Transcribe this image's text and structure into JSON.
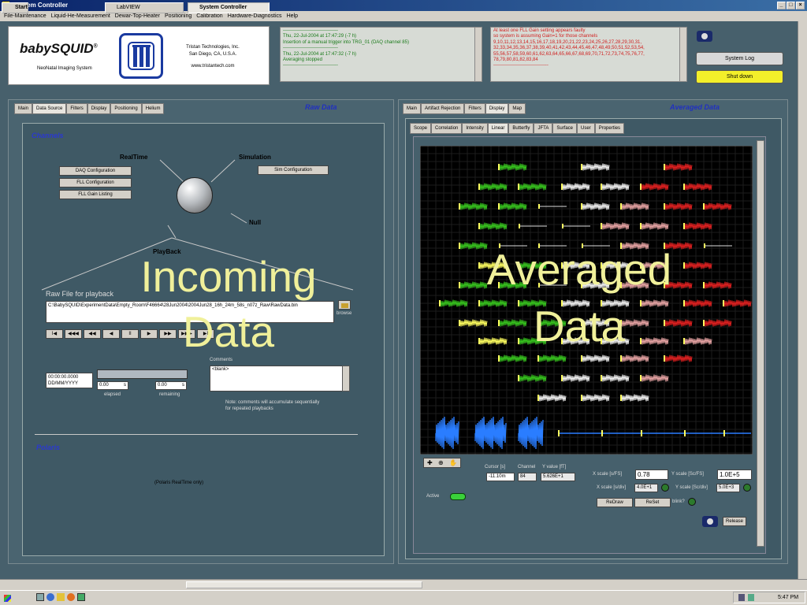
{
  "window": {
    "title": "System Controller"
  },
  "menu": [
    "File-Maintenance",
    "Liquid-He-Measurement",
    "Dewar-Top-Heater",
    "Positioning",
    "Calibration",
    "Hardware-Diagnostics",
    "Help"
  ],
  "logo": {
    "name": "babySQUID",
    "reg": "®",
    "subtitle": "NeoNatal Imaging System",
    "company_lines": [
      "Tristan Technologies, Inc.",
      "San Diego, CA, U.S.A.",
      "www.tristantech.com"
    ]
  },
  "log_left": "-----------------------------------\nThu, 22-Jul-2004 at 17:47:29 (-7 h)\nInsertion of a manual trigger into TRG_01 (DAQ channel 85)\n-----------------------------------\nThu, 22-Jul-2004 at 17:47:32 (-7 h)\nAveraging stopped\n-----------------------------------",
  "log_right": "At least one FLL Gain setting appears faulty\nso system is assuming Gain=1 for those channels\n9,10,11,12,13,14,15,16,17,18,19,20,21,22,23,24,25,26,27,28,29,30,31,\n32,33,34,35,36,37,38,39,40,41,42,43,44,45,46,47,48,49,50,51,52,53,54,\n55,56,57,58,59,60,61,62,63,64,65,66,67,68,69,70,71,72,73,74,75,76,77,\n78,79,80,81,82,83,84\n-----------------------------------",
  "buttons": {
    "system_log": "System Log",
    "shut_down": "Shut down"
  },
  "left": {
    "panel_title": "Raw Data",
    "tabs": [
      "Main",
      "Data Source",
      "Filters",
      "Display",
      "Positioning",
      "Helium"
    ],
    "channels_label": "Channels",
    "realtime": "RealTime",
    "simulation": "Simulation",
    "null": "Null",
    "playback": "PlayBack",
    "daq_config": "DAQ Configuration",
    "fll_config": "FLL Configuration",
    "fll_gain": "FLL Gain Listing",
    "sim_config": "Sim Configuration",
    "raw_file_label": "Raw File for playback",
    "raw_file_path": "C:\\BabySQUID\\ExperimentData\\Empty_Room\\F46664\\28Jun2004\\2004Jun28_16h_24m_58s_n07z_Raw\\RawData.bin",
    "browse": "browse",
    "transport": [
      "I◀",
      "◀◀◀",
      "◀◀",
      "◀",
      "II",
      "▶",
      "▶▶",
      "▶▶▶",
      "▶I"
    ],
    "time_value": "00:00:00.0000\nDD/MM/YYYY",
    "elapsed_value": "0.00",
    "elapsed_unit": "s",
    "elapsed_label": "elapsed",
    "remaining_value": "0.00",
    "remaining_unit": "s",
    "remaining_label": "remaining",
    "comments_label": "Comments",
    "comments_value": "<blank>",
    "comments_note": "Note: comments will accumulate sequentially\nfor repeated playbacks",
    "polaris_label": "Polaris",
    "polaris_note": "(Polaris RealTime only)",
    "overlay": "Incoming\nData"
  },
  "right": {
    "panel_title": "Averaged Data",
    "tabs": [
      "Main",
      "Artifact Rejection",
      "Filters",
      "Display",
      "Map"
    ],
    "subtabs": [
      "Scope",
      "Correlation",
      "Intensity",
      "Linear",
      "Butterfly",
      "JFTA",
      "Surface",
      "User",
      "Properties"
    ],
    "cursor_label": "Cursor [s]",
    "cursor_value": "-11.10m",
    "channel_label": "Channel",
    "channel_value": "84",
    "yvalue_label": "Y value [fT]",
    "yvalue_value": "5.626E+1",
    "xscale_fs_label": "X scale [s/FS]",
    "xscale_fs_value": "0.78",
    "yscale_fs_label": "Y scale [Sc/FS]",
    "yscale_fs_value": "1.0E+5",
    "xscale_div_label": "X scale [s/div]",
    "xscale_div_value": "4.0E+1",
    "yscale_div_label": "Y scale [Sc/div]",
    "yscale_div_value": "5.0E+3",
    "redraw": "ReDraw",
    "reset": "ReSet",
    "blink": "blink?",
    "active_label": "Active",
    "release": "Release",
    "overlay": "Averaged\nData",
    "colors": {
      "green": "#37c41e",
      "white": "#f2f2f2",
      "red": "#e02020",
      "pink": "#e7a4a4",
      "yellow": "#ffff60",
      "blue": "#2a7dff"
    }
  },
  "taskbar": {
    "start": "Start",
    "labview": "LabVIEW",
    "active": "System Controller",
    "clock": "5:47 PM"
  }
}
